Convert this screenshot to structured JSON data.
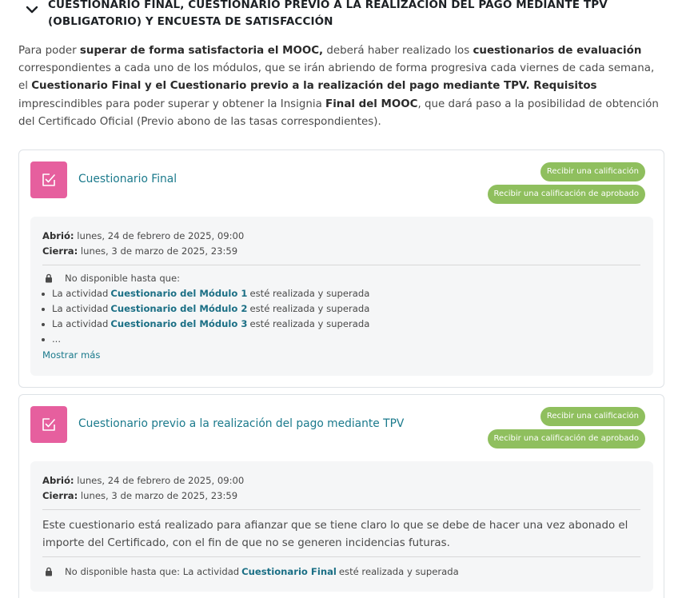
{
  "section": {
    "title": "CUESTIONARIO FINAL, CUESTIONARIO PREVIO A LA REALIZACIÓN DEL PAGO MEDIANTE TPV (OBLIGATORIO) Y ENCUESTA DE SATISFACCIÓN"
  },
  "intro": {
    "p1": "Para poder ",
    "b1": "superar de forma satisfactoria el MOOC,",
    "p2": " deberá haber realizado los ",
    "b2": "cuestionarios de evaluación",
    "p3": " correspondientes a cada uno de los módulos, que se irán abriendo de forma progresiva cada viernes de cada semana, el ",
    "b3": "Cuestionario Final y el Cuestionario previo a la realización del pago mediante TPV. Requisitos",
    "p4": " imprescindibles para poder superar y obtener la Insignia ",
    "b4": "Final del MOOC",
    "p5": ", que dará paso a la posibilidad de obtención del Certificado Oficial (Previo abono de las tasas correspondientes)."
  },
  "activities": [
    {
      "title": "Cuestionario Final",
      "badge1": "Recibir una calificación",
      "badge2": "Recibir una calificación de aprobado",
      "opened_label": "Abrió:",
      "opened_value": " lunes, 24 de febrero de 2025, 09:00",
      "closes_label": "Cierra:",
      "closes_value": " lunes, 3 de marzo de 2025, 23:59",
      "restriction": "No disponible hasta que:",
      "requirements": [
        {
          "prefix": "La actividad",
          "link": "Cuestionario del Módulo 1",
          "suffix": "esté realizada y superada"
        },
        {
          "prefix": "La actividad",
          "link": "Cuestionario del Módulo 2",
          "suffix": "esté realizada y superada"
        },
        {
          "prefix": "La actividad",
          "link": "Cuestionario del Módulo 3",
          "suffix": "esté realizada y superada"
        }
      ],
      "ellipsis": "...",
      "show_more": "Mostrar más"
    },
    {
      "title": "Cuestionario previo a la realización del pago mediante TPV",
      "badge1": "Recibir una calificación",
      "badge2": "Recibir una calificación de aprobado",
      "opened_label": "Abrió:",
      "opened_value": " lunes, 24 de febrero de 2025, 09:00",
      "closes_label": "Cierra:",
      "closes_value": " lunes, 3 de marzo de 2025, 23:59",
      "description": "Este cuestionario está realizado para afianzar que se tiene claro lo que se debe de hacer una vez abonado el importe del Certificado, con el fin de que no se generen incidencias futuras.",
      "restriction_prefix": "No disponible hasta que: La actividad",
      "restriction_link": "Cuestionario Final",
      "restriction_suffix": "esté realizada y superada"
    }
  ],
  "colors": {
    "quiz_icon": "#e65f9e",
    "badge": "#8fbf5e",
    "link": "#1b7a8c"
  }
}
